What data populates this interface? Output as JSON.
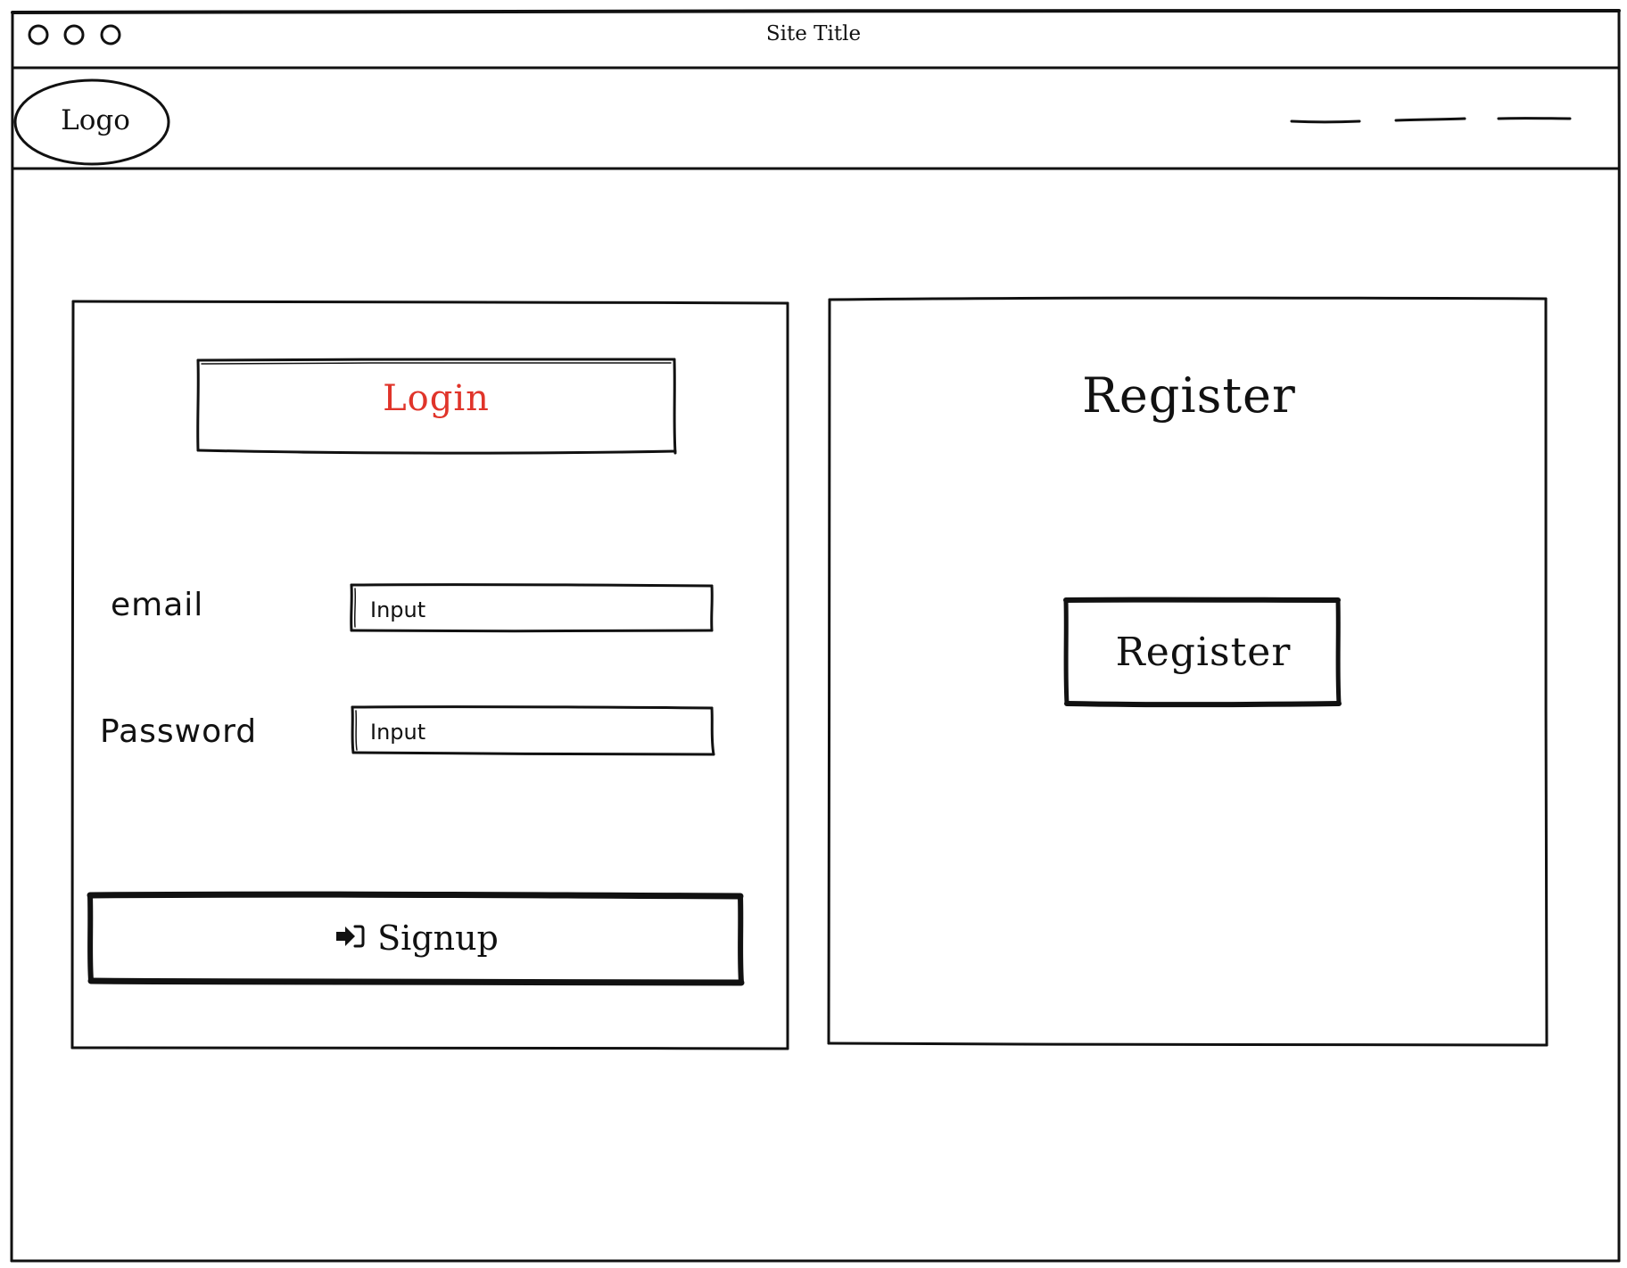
{
  "window": {
    "title": "Site Title",
    "controls": [
      "circle-icon",
      "circle-icon",
      "circle-icon"
    ]
  },
  "header": {
    "logo_label": "Logo",
    "nav_items": [
      "",
      "",
      ""
    ]
  },
  "login_panel": {
    "heading": "Login",
    "heading_color": "#e0342a",
    "email_label": "email",
    "email_placeholder": "Input",
    "password_label": "Password",
    "password_placeholder": "Input",
    "signup_icon": "sign-in-icon",
    "signup_label": "Signup"
  },
  "register_panel": {
    "heading": "Register",
    "button_label": "Register"
  }
}
